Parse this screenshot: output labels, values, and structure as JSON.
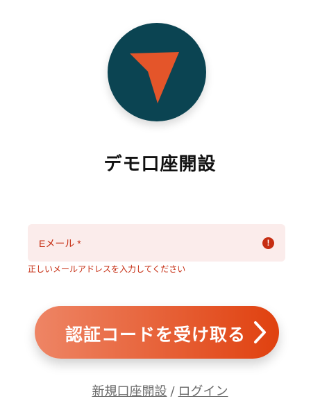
{
  "app": {
    "logo_icon": "arrow-cursor-icon",
    "logo_bg_color": "#0b4452",
    "logo_arrow_color": "#e4552a"
  },
  "page": {
    "title": "デモ口座開設"
  },
  "form": {
    "email_label": "Eメール *",
    "email_value": "",
    "error_message": "正しいメールアドレスを入力してください",
    "error_color": "#c62d12",
    "field_bg_color": "#fbeceb"
  },
  "actions": {
    "submit_label": "認証コードを受け取る",
    "submit_gradient_start": "#ee8565",
    "submit_gradient_end": "#e0410f",
    "chevron_icon": "chevron-right-icon",
    "register_link": "新規口座開設",
    "separator": "/",
    "login_link": "ログイン"
  }
}
